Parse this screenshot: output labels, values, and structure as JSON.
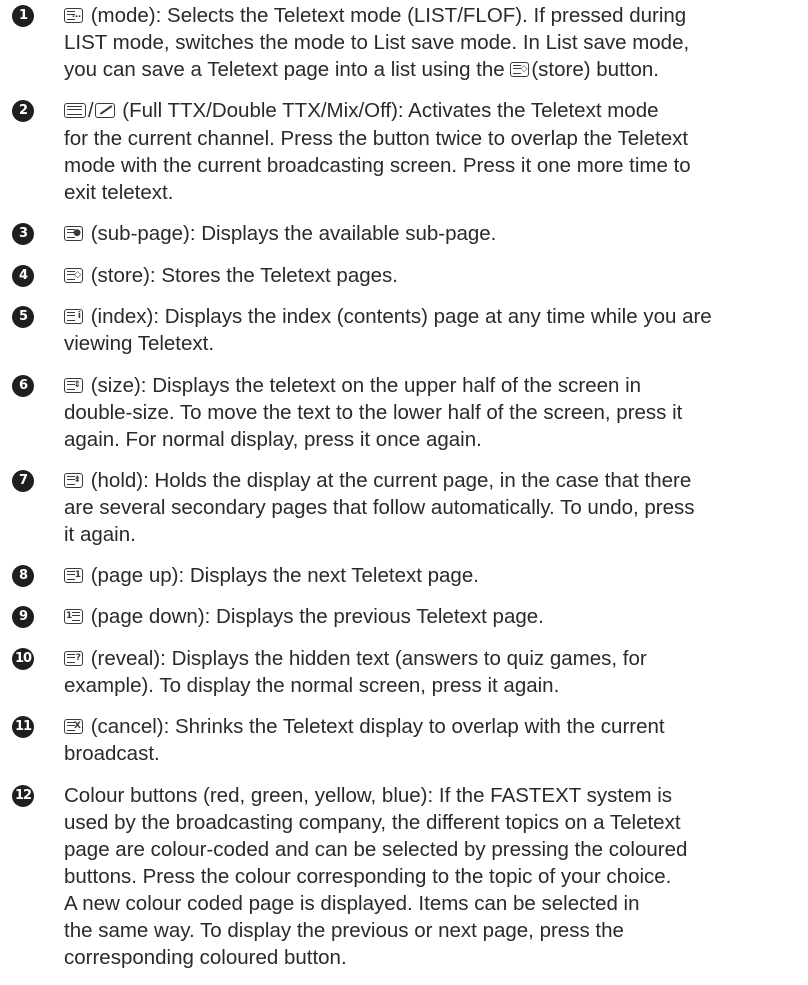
{
  "items": [
    {
      "num": "1",
      "icon": "teletext-mode-icon",
      "lines": [
        " (mode): Selects the Teletext mode (LIST/FLOF). If pressed during",
        "LIST mode, switches the mode to List save mode. In List save mode,",
        "you can save a Teletext page into a list using the ",
        "(store) button."
      ]
    },
    {
      "num": "2",
      "icon": "teletext-full-double-icon",
      "lines": [
        " (Full TTX/Double TTX/Mix/Off): Activates the Teletext mode",
        "for the current channel. Press the button twice to overlap the Teletext",
        "mode with the current broadcasting screen. Press it one more time to",
        "exit teletext."
      ]
    },
    {
      "num": "3",
      "icon": "teletext-subpage-icon",
      "lines": [
        " (sub-page): Displays the available sub-page."
      ]
    },
    {
      "num": "4",
      "icon": "teletext-store-icon",
      "lines": [
        " (store): Stores the Teletext pages."
      ]
    },
    {
      "num": "5",
      "icon": "teletext-index-icon",
      "lines": [
        " (index): Displays the index (contents) page at any time while you are",
        "viewing Teletext."
      ]
    },
    {
      "num": "6",
      "icon": "teletext-size-icon",
      "lines": [
        " (size): Displays the teletext on the upper half of the screen in",
        "double-size. To move the text to the lower half of the screen, press it",
        "again. For normal display, press it once again."
      ]
    },
    {
      "num": "7",
      "icon": "teletext-hold-icon",
      "lines": [
        " (hold): Holds the display at the current page, in the case that there",
        "are several secondary pages that follow automatically. To undo, press",
        "it again."
      ]
    },
    {
      "num": "8",
      "icon": "teletext-page-up-icon",
      "lines": [
        " (page up): Displays the next Teletext page."
      ]
    },
    {
      "num": "9",
      "icon": "teletext-page-down-icon",
      "lines": [
        " (page down): Displays the previous Teletext page."
      ]
    },
    {
      "num": "10",
      "icon": "teletext-reveal-icon",
      "lines": [
        " (reveal): Displays the hidden text (answers to quiz games, for",
        "example). To display the normal screen, press it again."
      ]
    },
    {
      "num": "11",
      "icon": "teletext-cancel-icon",
      "lines": [
        " (cancel): Shrinks the Teletext display to overlap with the current",
        "broadcast."
      ]
    },
    {
      "num": "12",
      "icon": "",
      "lines": [
        "Colour buttons (red, green, yellow, blue): If the FASTEXT system is",
        "used by the broadcasting company, the different topics on a Teletext",
        "page are colour-coded and can be selected by pressing the coloured",
        "buttons. Press the colour corresponding to the topic of your choice.",
        "A new colour coded page is displayed. Items can be selected in",
        "the same way. To display the previous or next page, press the",
        "corresponding coloured button."
      ]
    }
  ]
}
